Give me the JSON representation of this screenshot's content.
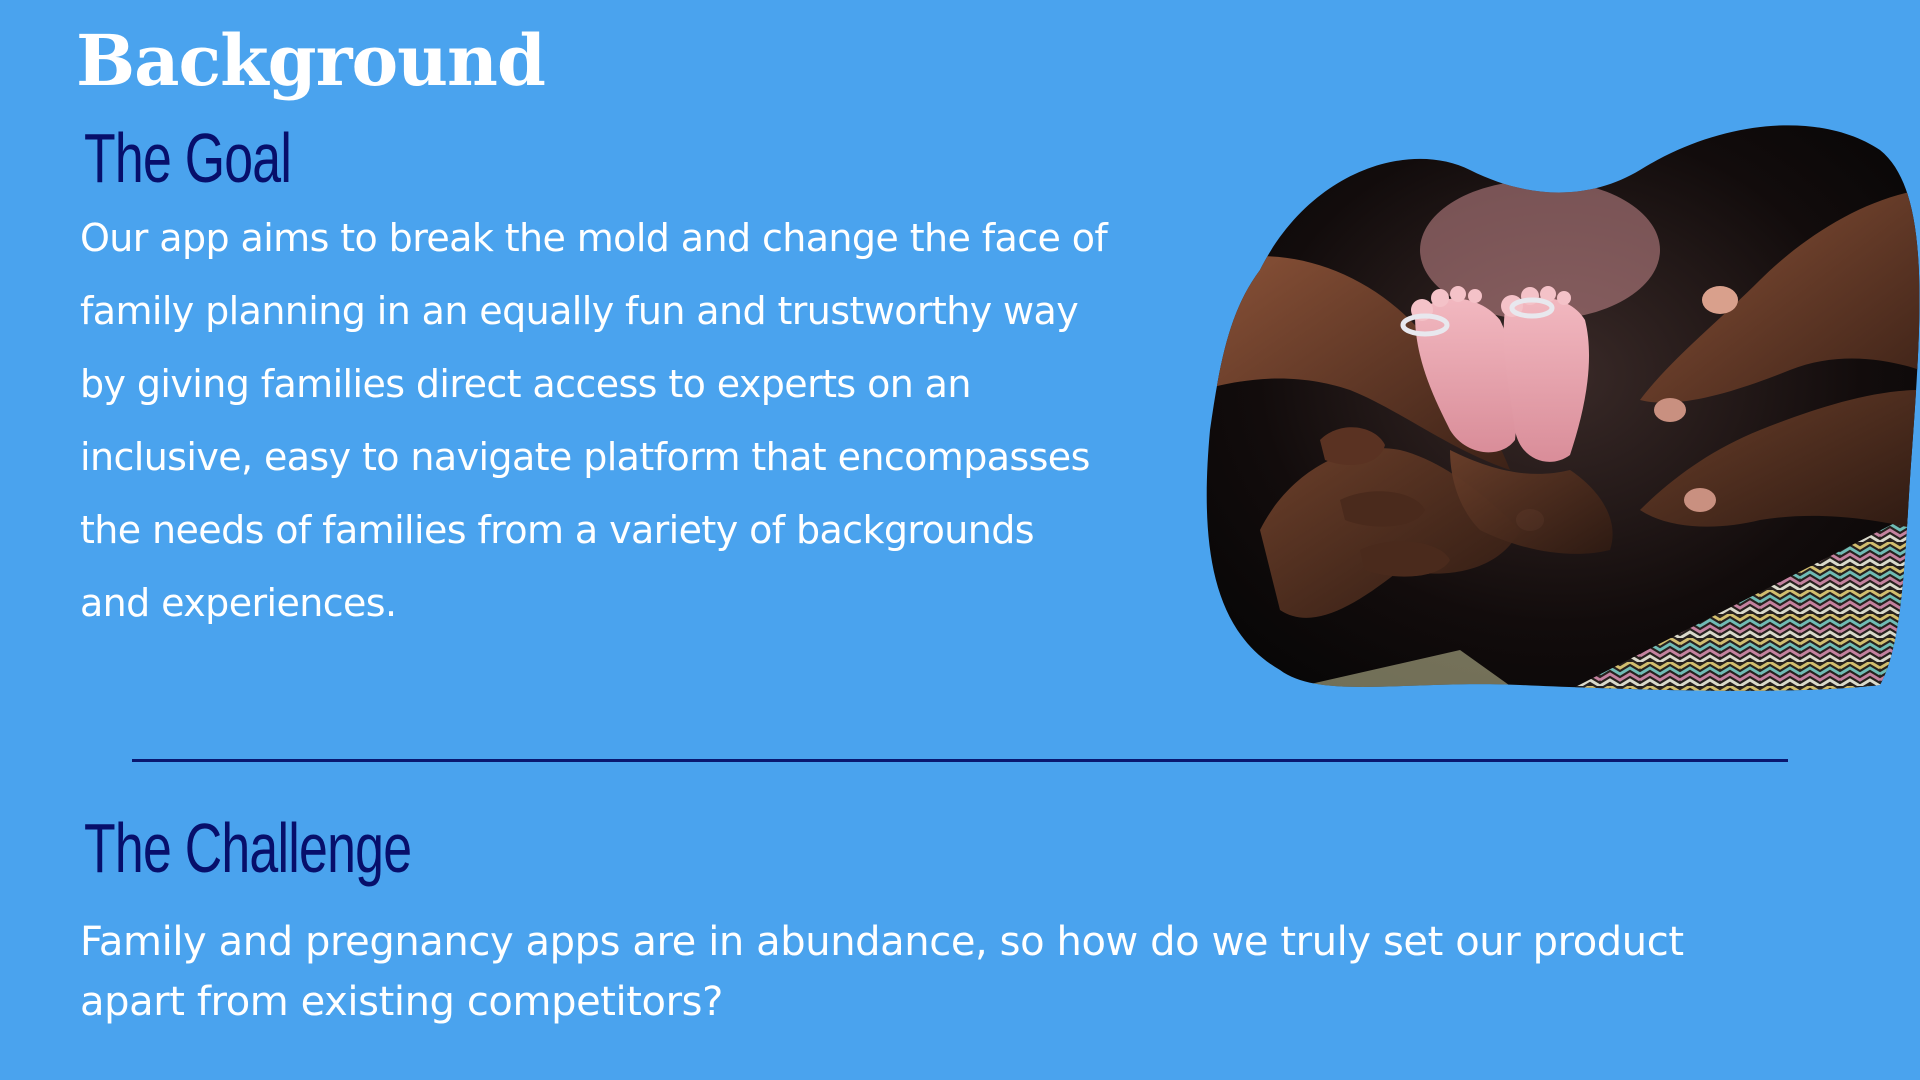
{
  "slide": {
    "title": "Background",
    "goal": {
      "heading": "The Goal",
      "lines": [
        "Our app aims to break the mold and change the face of",
        "family planning in an equally fun and trustworthy way",
        "by giving families direct access to experts on an",
        "inclusive, easy to navigate platform that encompasses",
        "the needs of families from a variety of backgrounds",
        "and experiences."
      ]
    },
    "challenge": {
      "heading": "The Challenge",
      "lines": [
        "Family and pregnancy apps are in abundance, so how do we truly set our product",
        "apart from existing competitors?"
      ]
    }
  },
  "colors": {
    "background": "#4aa3ee",
    "heading": "#070f6b",
    "text": "#ffffff",
    "divider": "#0a1870"
  },
  "image": {
    "subject": "hands-cradling-baby-feet-photo"
  }
}
